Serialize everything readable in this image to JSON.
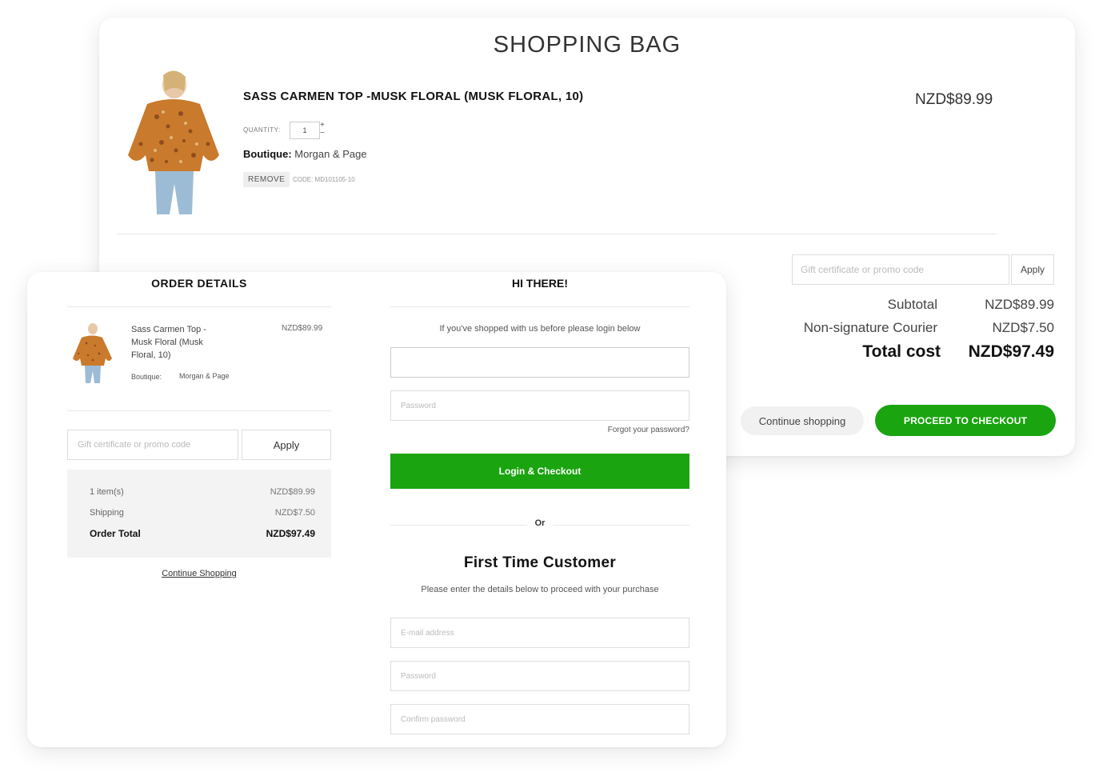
{
  "bag": {
    "title": "SHOPPING BAG",
    "product_name": "SASS CARMEN TOP -MUSK FLORAL (MUSK FLORAL, 10)",
    "product_price": "NZD$89.99",
    "quantity_label": "QUANTITY:",
    "quantity_value": "1",
    "boutique_label": "Boutique:",
    "boutique_value": "Morgan & Page",
    "remove_label": "REMOVE",
    "code_text": "CODE: MD101105-10",
    "promo_placeholder": "Gift certificate or promo code",
    "apply_label": "Apply",
    "subtotal_label": "Subtotal",
    "subtotal_value": "NZD$89.99",
    "courier_label": "Non-signature Courier",
    "courier_value": "NZD$7.50",
    "total_label": "Total cost",
    "total_value": "NZD$97.49",
    "continue_label": "Continue shopping",
    "checkout_label": "PROCEED TO CHECKOUT"
  },
  "order": {
    "title": "ORDER DETAILS",
    "item_name": "Sass Carmen Top - Musk Floral (Musk Floral, 10)",
    "item_price": "NZD$89.99",
    "boutique_label": "Boutique:",
    "boutique_value": "Morgan & Page",
    "promo_placeholder": "Gift certificate or promo code",
    "apply_label": "Apply",
    "items_label": "1 item(s)",
    "items_value": "NZD$89.99",
    "shipping_label": "Shipping",
    "shipping_value": "NZD$7.50",
    "total_label": "Order Total",
    "total_value": "NZD$97.49",
    "continue_label": "Continue Shopping"
  },
  "login": {
    "title": "HI THERE!",
    "subtitle": "If you've shopped with us before please login below",
    "email_placeholder": "",
    "password_placeholder": "Password",
    "forgot_label": "Forgot your password?",
    "login_label": "Login & Checkout",
    "or_label": "Or",
    "ftc_title": "First Time Customer",
    "ftc_subtitle": "Please enter the details below to proceed with your purchase",
    "new_email_placeholder": "E-mail address",
    "new_password_placeholder": "Password",
    "confirm_placeholder": "Confirm password"
  },
  "colors": {
    "accent_green": "#1aa40f",
    "muted_bg": "#f3f3f3"
  }
}
